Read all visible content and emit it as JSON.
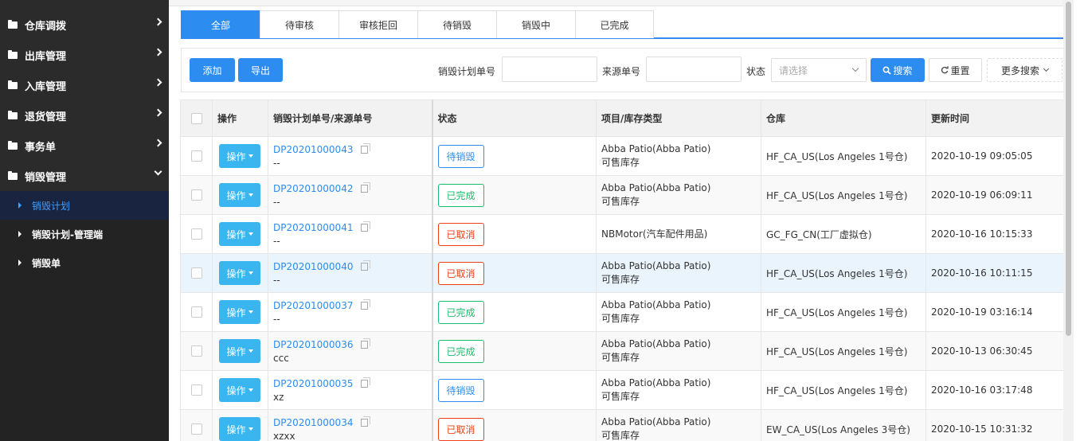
{
  "sidebar": {
    "items": [
      {
        "label": "仓库调拨",
        "expanded": false
      },
      {
        "label": "出库管理",
        "expanded": false
      },
      {
        "label": "入库管理",
        "expanded": false
      },
      {
        "label": "退货管理",
        "expanded": false
      },
      {
        "label": "事务单",
        "expanded": false
      },
      {
        "label": "销毁管理",
        "expanded": true
      }
    ],
    "sub_items": [
      {
        "label": "销毁计划",
        "active": true
      },
      {
        "label": "销毁计划-管理端",
        "active": false
      },
      {
        "label": "销毁单",
        "active": false
      }
    ]
  },
  "tabs": [
    {
      "label": "全部",
      "active": true
    },
    {
      "label": "待审核",
      "active": false
    },
    {
      "label": "审核拒回",
      "active": false
    },
    {
      "label": "待销毁",
      "active": false
    },
    {
      "label": "销毁中",
      "active": false
    },
    {
      "label": "已完成",
      "active": false
    }
  ],
  "toolbar": {
    "add_label": "添加",
    "export_label": "导出",
    "plan_no_label": "销毁计划单号",
    "plan_no_value": "",
    "source_no_label": "来源单号",
    "source_no_value": "",
    "status_label": "状态",
    "status_placeholder": "请选择",
    "search_label": "搜索",
    "reset_label": "重置",
    "more_label": "更多搜索"
  },
  "table": {
    "headers": {
      "action": "操作",
      "plan": "销毁计划单号/来源单号",
      "status": "状态",
      "project": "项目/库存类型",
      "warehouse": "仓库",
      "updated": "更新时间"
    },
    "op_label": "操作",
    "rows": [
      {
        "plan_no": "DP20201000043",
        "source_no": "--",
        "status": "待销毁",
        "status_color": "#2d8cf0",
        "project": "Abba Patio(Abba Patio)",
        "stock_type": "可售库存",
        "warehouse": "HF_CA_US(Los Angeles 1号仓)",
        "updated": "2020-10-19 09:05:05"
      },
      {
        "plan_no": "DP20201000042",
        "source_no": "--",
        "status": "已完成",
        "status_color": "#19be6b",
        "project": "Abba Patio(Abba Patio)",
        "stock_type": "可售库存",
        "warehouse": "HF_CA_US(Los Angeles 1号仓)",
        "updated": "2020-10-19 06:09:11"
      },
      {
        "plan_no": "DP20201000041",
        "source_no": "--",
        "status": "已取消",
        "status_color": "#ed4014",
        "project": "NBMotor(汽车配件用品)",
        "stock_type": "",
        "warehouse": "GC_FG_CN(工厂虚拟仓)",
        "updated": "2020-10-16 10:15:33"
      },
      {
        "plan_no": "DP20201000040",
        "source_no": "--",
        "status": "已取消",
        "status_color": "#ed4014",
        "project": "Abba Patio(Abba Patio)",
        "stock_type": "可售库存",
        "warehouse": "HF_CA_US(Los Angeles 1号仓)",
        "updated": "2020-10-16 10:11:15"
      },
      {
        "plan_no": "DP20201000037",
        "source_no": "--",
        "status": "已完成",
        "status_color": "#19be6b",
        "project": "Abba Patio(Abba Patio)",
        "stock_type": "可售库存",
        "warehouse": "HF_CA_US(Los Angeles 1号仓)",
        "updated": "2020-10-19 03:16:14"
      },
      {
        "plan_no": "DP20201000036",
        "source_no": "ccc",
        "status": "已完成",
        "status_color": "#19be6b",
        "project": "Abba Patio(Abba Patio)",
        "stock_type": "可售库存",
        "warehouse": "HF_CA_US(Los Angeles 1号仓)",
        "updated": "2020-10-13 06:30:45"
      },
      {
        "plan_no": "DP20201000035",
        "source_no": "xz",
        "status": "待销毁",
        "status_color": "#2d8cf0",
        "project": "Abba Patio(Abba Patio)",
        "stock_type": "可售库存",
        "warehouse": "HF_CA_US(Los Angeles 1号仓)",
        "updated": "2020-10-16 03:17:48"
      },
      {
        "plan_no": "DP20201000034",
        "source_no": "xzxx",
        "status": "已取消",
        "status_color": "#ed4014",
        "project": "Abba Patio(Abba Patio)",
        "stock_type": "可售库存",
        "warehouse": "EW_CA_US(Los Angeles 3号仓)",
        "updated": "2020-10-15 10:31:32"
      }
    ]
  }
}
